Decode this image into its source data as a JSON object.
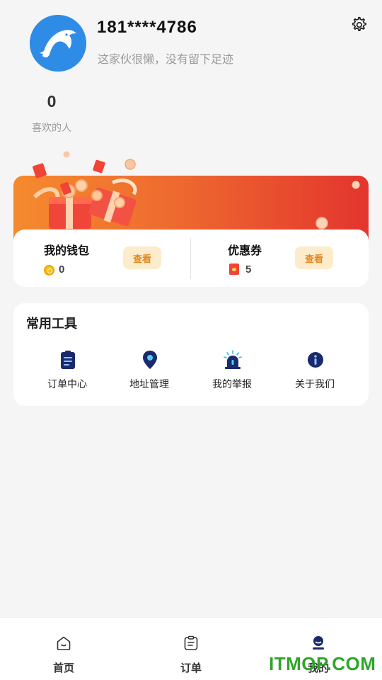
{
  "profile": {
    "phone": "181****4786",
    "bio": "这家伙很懒，没有留下足迹",
    "likes_count": "0",
    "likes_label": "喜欢的人"
  },
  "icons": {
    "settings": "gear-icon",
    "avatar": "dolphin-avatar"
  },
  "wallet": {
    "title": "我的钱包",
    "value": "0",
    "button": "查看"
  },
  "coupon": {
    "title": "优惠券",
    "value": "5",
    "button": "查看"
  },
  "tools": {
    "title": "常用工具",
    "items": [
      {
        "label": "订单中心",
        "icon": "clipboard-list-icon"
      },
      {
        "label": "地址管理",
        "icon": "location-pin-icon"
      },
      {
        "label": "我的举报",
        "icon": "alarm-siren-icon"
      },
      {
        "label": "关于我们",
        "icon": "info-icon"
      }
    ]
  },
  "nav": {
    "items": [
      {
        "label": "首页",
        "icon": "home-icon"
      },
      {
        "label": "订单",
        "icon": "order-icon"
      },
      {
        "label": "我的",
        "icon": "profile-icon",
        "active": true
      }
    ]
  },
  "watermark": "ITMOP.COM",
  "colors": {
    "accent_orange": "#f58a2e",
    "accent_red": "#e3352e",
    "button_bg": "#fdeccc",
    "button_text": "#e48a22",
    "icon_navy": "#1a2a6c",
    "avatar_blue": "#2e8be6",
    "watermark_green": "#2fa52b"
  }
}
